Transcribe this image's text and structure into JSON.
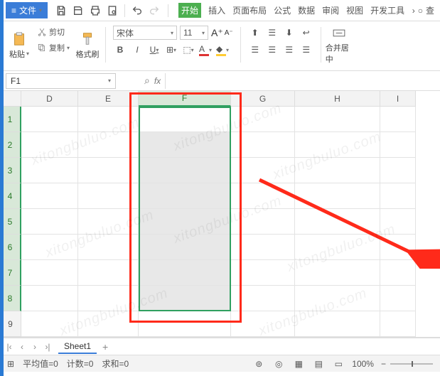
{
  "menu": {
    "file": "文件",
    "tabs": [
      "开始",
      "插入",
      "页面布局",
      "公式",
      "数据",
      "审阅",
      "视图",
      "开发工具"
    ],
    "active_tab_index": 0,
    "search_label": "查"
  },
  "ribbon": {
    "paste": "粘贴",
    "cut": "剪切",
    "copy": "复制",
    "format_painter": "格式刷",
    "font_name": "宋体",
    "font_size": "11",
    "bold": "B",
    "italic": "I",
    "underline": "U",
    "merge_center": "合并居中"
  },
  "namebox": {
    "value": "F1",
    "fx": "fx"
  },
  "columns": [
    "D",
    "E",
    "F",
    "G",
    "H",
    "I"
  ],
  "selected_column_index": 2,
  "rows": [
    1,
    2,
    3,
    4,
    5,
    6,
    7,
    8,
    9
  ],
  "selected_rows_end": 8,
  "selection_range": "F1:F8",
  "sheet": {
    "name": "Sheet1"
  },
  "status": {
    "avg_label": "平均值=",
    "avg_value": "0",
    "count_label": "计数=",
    "count_value": "0",
    "sum_label": "求和=",
    "sum_value": "0",
    "zoom": "100%"
  },
  "watermark_text": "xitongbuluo.com"
}
